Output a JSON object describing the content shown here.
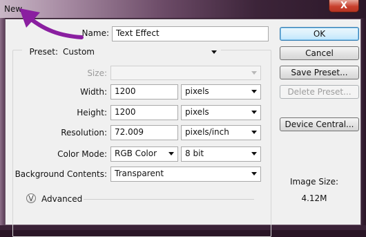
{
  "window": {
    "title": "New",
    "close_glyph": "X"
  },
  "form": {
    "name_label": "Name:",
    "name_value": "Text Effect",
    "preset_label": "Preset:",
    "preset_value": "Custom",
    "size_label": "Size:",
    "size_value": "",
    "width_label": "Width:",
    "width_value": "1200",
    "width_unit": "pixels",
    "height_label": "Height:",
    "height_value": "1200",
    "height_unit": "pixels",
    "resolution_label": "Resolution:",
    "resolution_value": "72.009",
    "resolution_unit": "pixels/inch",
    "color_mode_label": "Color Mode:",
    "color_mode_value": "RGB Color",
    "bit_depth_value": "8 bit",
    "background_label": "Background Contents:",
    "background_value": "Transparent",
    "advanced_label": "Advanced"
  },
  "buttons": {
    "ok": "OK",
    "cancel": "Cancel",
    "save_preset": "Save Preset...",
    "delete_preset": "Delete Preset...",
    "device_central": "Device Central..."
  },
  "image_size": {
    "label": "Image Size:",
    "value": "4.12M"
  },
  "icons": {
    "annotation_arrow": "purple-arrow-icon",
    "advanced_toggle": "chevron-down-circle-icon"
  },
  "colors": {
    "arrow": "#8a1fa0",
    "default_button_border": "#3c7fb1"
  }
}
